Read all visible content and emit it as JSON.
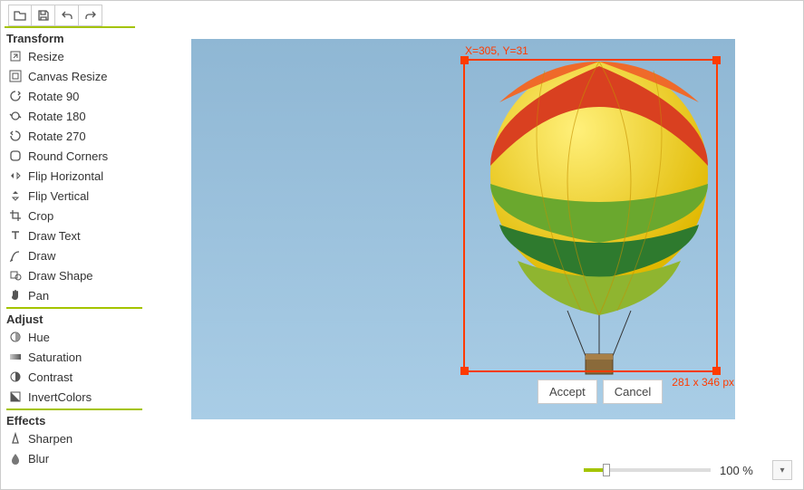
{
  "toolbar": {
    "open": "Open",
    "save": "Save",
    "undo": "Undo",
    "redo": "Redo"
  },
  "sections": {
    "transform": {
      "title": "Transform",
      "items": [
        {
          "icon": "resize",
          "label": "Resize"
        },
        {
          "icon": "canvas-resize",
          "label": "Canvas Resize"
        },
        {
          "icon": "rotate-90",
          "label": "Rotate 90"
        },
        {
          "icon": "rotate-180",
          "label": "Rotate 180"
        },
        {
          "icon": "rotate-270",
          "label": "Rotate 270"
        },
        {
          "icon": "round-corners",
          "label": "Round Corners"
        },
        {
          "icon": "flip-h",
          "label": "Flip Horizontal"
        },
        {
          "icon": "flip-v",
          "label": "Flip Vertical"
        },
        {
          "icon": "crop",
          "label": "Crop"
        },
        {
          "icon": "draw-text",
          "label": "Draw Text"
        },
        {
          "icon": "draw",
          "label": "Draw"
        },
        {
          "icon": "draw-shape",
          "label": "Draw Shape"
        },
        {
          "icon": "pan",
          "label": "Pan"
        }
      ]
    },
    "adjust": {
      "title": "Adjust",
      "items": [
        {
          "icon": "hue",
          "label": "Hue"
        },
        {
          "icon": "saturation",
          "label": "Saturation"
        },
        {
          "icon": "contrast",
          "label": "Contrast"
        },
        {
          "icon": "invert",
          "label": "InvertColors"
        }
      ]
    },
    "effects": {
      "title": "Effects",
      "items": [
        {
          "icon": "sharpen",
          "label": "Sharpen"
        },
        {
          "icon": "blur",
          "label": "Blur"
        }
      ]
    }
  },
  "crop": {
    "coords": "X=305, Y=31",
    "size": "281 x 346 px",
    "accept": "Accept",
    "cancel": "Cancel"
  },
  "zoom": {
    "value": "100 %"
  }
}
